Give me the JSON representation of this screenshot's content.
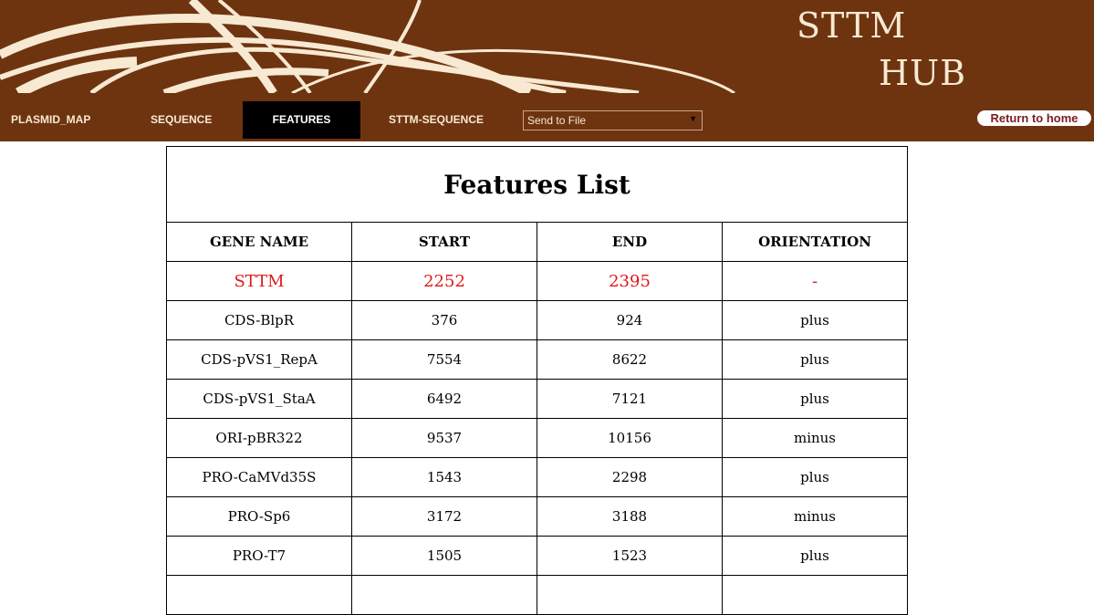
{
  "header": {
    "logo_line1": "STTM",
    "logo_line2": "HUB"
  },
  "nav": {
    "plasmid_map": "PLASMID_MAP",
    "sequence": "SEQUENCE",
    "features": "FEATURES",
    "sttm_sequence": "STTM-SEQUENCE",
    "send_select_value": "Send to File",
    "return_home": "Return to home"
  },
  "table": {
    "title": "Features List",
    "headers": [
      "GENE NAME",
      "START",
      "END",
      "ORIENTATION"
    ],
    "rows": [
      [
        "STTM",
        "2252",
        "2395",
        "-"
      ],
      [
        "CDS-BlpR",
        "376",
        "924",
        "plus"
      ],
      [
        "CDS-pVS1_RepA",
        "7554",
        "8622",
        "plus"
      ],
      [
        "CDS-pVS1_StaA",
        "6492",
        "7121",
        "plus"
      ],
      [
        "ORI-pBR322",
        "9537",
        "10156",
        "minus"
      ],
      [
        "PRO-CaMVd35S",
        "1543",
        "2298",
        "plus"
      ],
      [
        "PRO-Sp6",
        "3172",
        "3188",
        "minus"
      ],
      [
        "PRO-T7",
        "1505",
        "1523",
        "plus"
      ]
    ]
  },
  "colors": {
    "brand_brown": "#6e3410",
    "logo_cream": "#f7e9d2",
    "highlight_red": "#e0161b",
    "active_tab": "#000000"
  }
}
